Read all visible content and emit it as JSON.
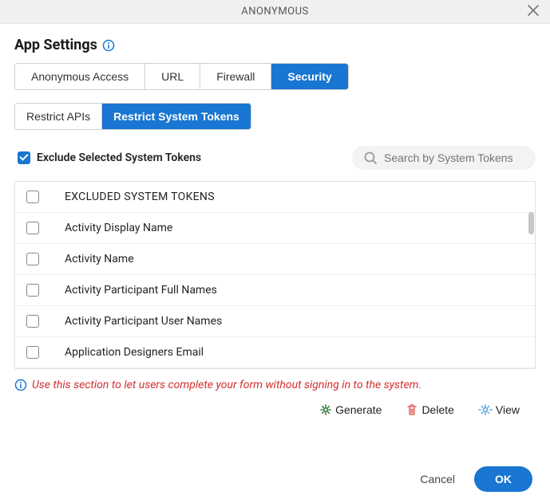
{
  "modal": {
    "title": "ANONYMOUS",
    "close_aria": "Close"
  },
  "section_title": "App Settings",
  "tabs": [
    {
      "label": "Anonymous Access",
      "active": false
    },
    {
      "label": "URL",
      "active": false
    },
    {
      "label": "Firewall",
      "active": false
    },
    {
      "label": "Security",
      "active": true
    }
  ],
  "subtabs": [
    {
      "label": "Restrict APIs",
      "active": false
    },
    {
      "label": "Restrict System Tokens",
      "active": true
    }
  ],
  "exclude": {
    "label": "Exclude Selected System Tokens",
    "checked": true
  },
  "search": {
    "placeholder": "Search by System Tokens"
  },
  "table": {
    "header": "EXCLUDED SYSTEM TOKENS",
    "rows": [
      "Activity Display Name",
      "Activity Name",
      "Activity Participant Full Names",
      "Activity Participant User Names",
      "Application Designers Email"
    ]
  },
  "info_text": "Use this section to let users complete your form without signing in to the system.",
  "actions": {
    "generate": "Generate",
    "delete": "Delete",
    "view": "View"
  },
  "footer": {
    "cancel": "Cancel",
    "ok": "OK"
  },
  "colors": {
    "primary": "#1976d2",
    "danger": "#d32f2f",
    "muted": "#888"
  }
}
